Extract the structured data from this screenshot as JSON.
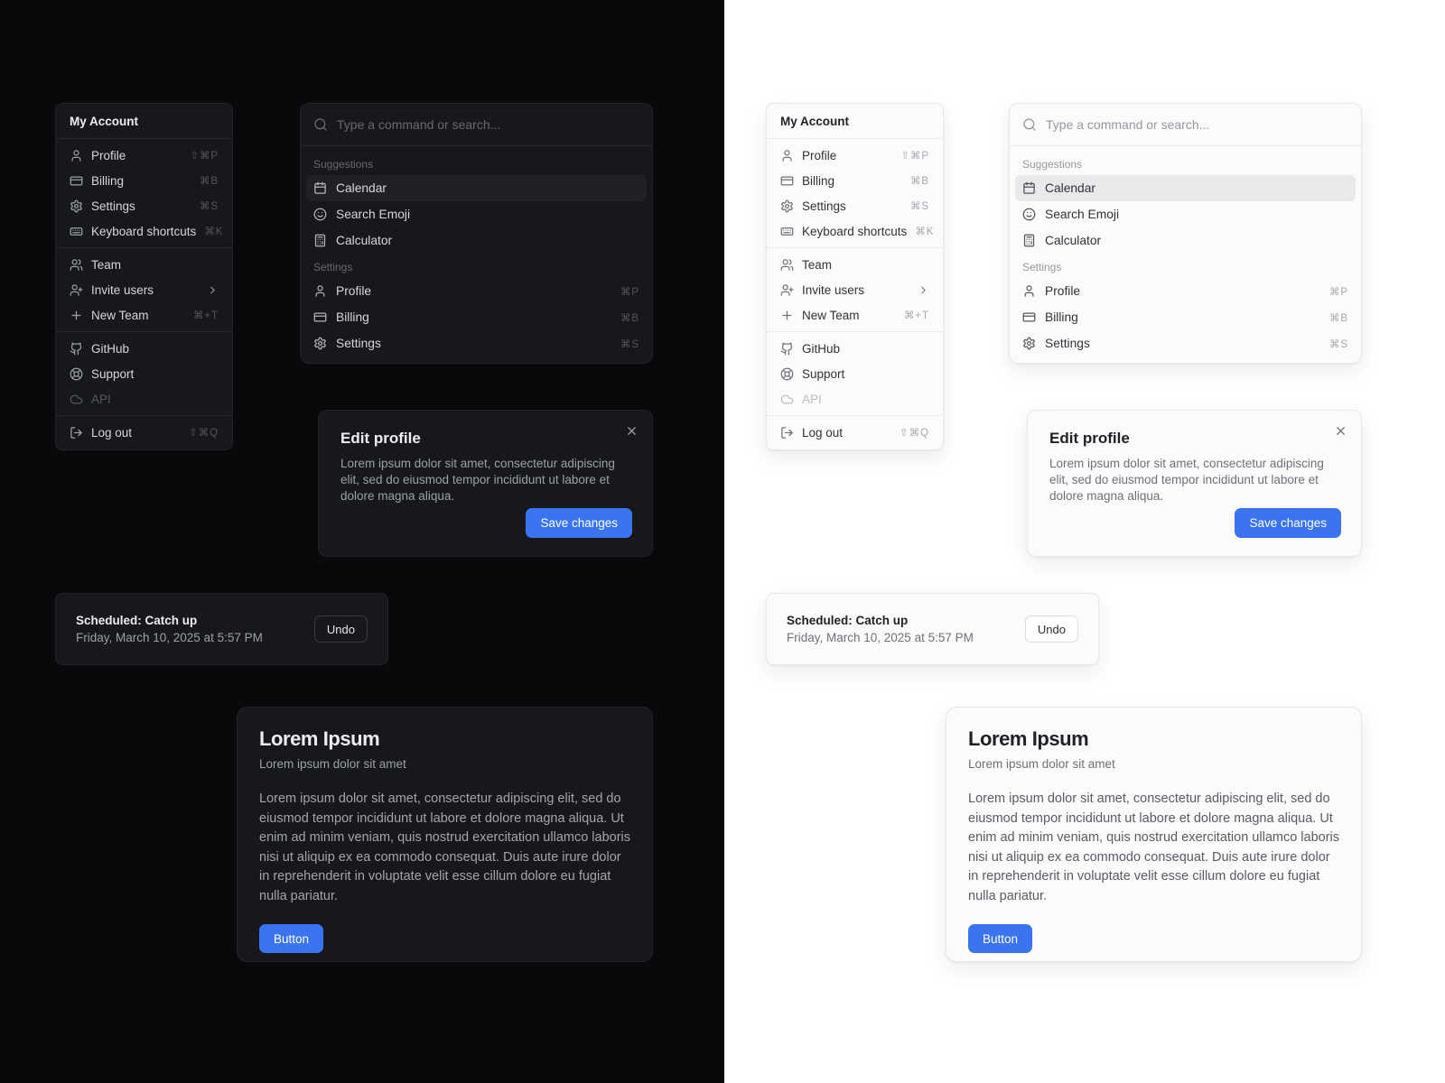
{
  "accent_color": "#3b74f0",
  "themes": {
    "left": "dark",
    "right": "light"
  },
  "menu": {
    "title": "My Account",
    "items": [
      {
        "label": "Profile",
        "shortcut": "⇧⌘P",
        "icon": "user"
      },
      {
        "label": "Billing",
        "shortcut": "⌘B",
        "icon": "credit-card"
      },
      {
        "label": "Settings",
        "shortcut": "⌘S",
        "icon": "gear"
      },
      {
        "label": "Keyboard shortcuts",
        "shortcut": "⌘K",
        "icon": "keyboard"
      },
      {
        "label": "Team",
        "shortcut": "",
        "icon": "users"
      },
      {
        "label": "Invite users",
        "shortcut": "",
        "icon": "user-plus",
        "submenu": true
      },
      {
        "label": "New Team",
        "shortcut": "⌘+T",
        "icon": "plus"
      },
      {
        "label": "GitHub",
        "shortcut": "",
        "icon": "github"
      },
      {
        "label": "Support",
        "shortcut": "",
        "icon": "life-buoy"
      },
      {
        "label": "API",
        "shortcut": "",
        "icon": "cloud",
        "disabled": true
      },
      {
        "label": "Log out",
        "shortcut": "⇧⌘Q",
        "icon": "log-out"
      }
    ]
  },
  "command_palette": {
    "placeholder": "Type a command or search...",
    "groups": [
      {
        "label": "Suggestions",
        "items": [
          {
            "label": "Calendar",
            "shortcut": "",
            "icon": "calendar",
            "selected": true
          },
          {
            "label": "Search Emoji",
            "shortcut": "",
            "icon": "smile"
          },
          {
            "label": "Calculator",
            "shortcut": "",
            "icon": "calculator"
          }
        ]
      },
      {
        "label": "Settings",
        "items": [
          {
            "label": "Profile",
            "shortcut": "⌘P",
            "icon": "user"
          },
          {
            "label": "Billing",
            "shortcut": "⌘B",
            "icon": "credit-card"
          },
          {
            "label": "Settings",
            "shortcut": "⌘S",
            "icon": "gear"
          }
        ]
      }
    ]
  },
  "dialog": {
    "title": "Edit profile",
    "description": "Lorem ipsum dolor sit amet, consectetur adipiscing elit, sed do eiusmod tempor incididunt ut labore et dolore magna aliqua.",
    "save_label": "Save changes"
  },
  "toast": {
    "title": "Scheduled: Catch up",
    "description": "Friday, March 10, 2025 at 5:57 PM",
    "action_label": "Undo"
  },
  "card": {
    "title": "Lorem Ipsum",
    "subtitle": "Lorem ipsum dolor sit amet",
    "body": "Lorem ipsum dolor sit amet, consectetur adipiscing elit, sed do eiusmod tempor incididunt ut labore et dolore magna aliqua. Ut enim ad minim veniam, quis nostrud exercitation ullamco laboris nisi ut aliquip ex ea commodo consequat. Duis aute irure dolor in reprehenderit in voluptate velit esse cillum dolore eu fugiat nulla pariatur.",
    "button_label": "Button"
  }
}
